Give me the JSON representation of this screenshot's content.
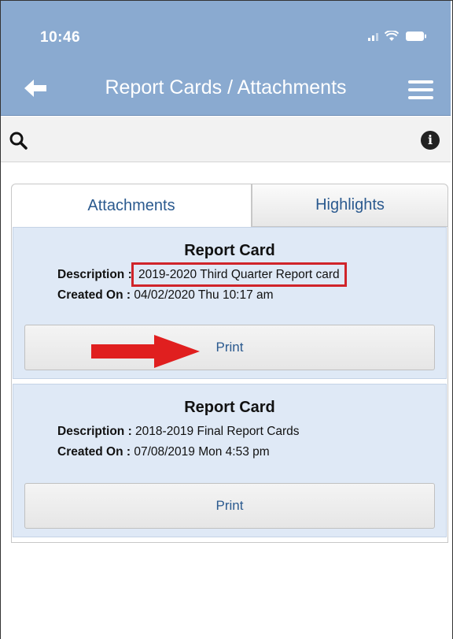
{
  "status_bar": {
    "time": "10:46"
  },
  "nav": {
    "title": "Report Cards / Attachments"
  },
  "tabs": [
    {
      "label": "Attachments"
    },
    {
      "label": "Highlights"
    }
  ],
  "cards": [
    {
      "title": "Report Card",
      "description_label": "Description :",
      "description": "2019-2020 Third Quarter Report card",
      "created_label": "Created On :",
      "created": "04/02/2020 Thu 10:17 am",
      "print_label": "Print"
    },
    {
      "title": "Report Card",
      "description_label": "Description :",
      "description": "2018-2019 Final Report Cards",
      "created_label": "Created On :",
      "created": "07/08/2019 Mon 4:53 pm",
      "print_label": "Print"
    }
  ],
  "annotations": {
    "highlight_color": "#d0242a",
    "arrow_color": "#e01f1f"
  },
  "colors": {
    "header": "#8aaad0",
    "card_bg": "#dfe9f6",
    "link": "#2b5a8f"
  }
}
